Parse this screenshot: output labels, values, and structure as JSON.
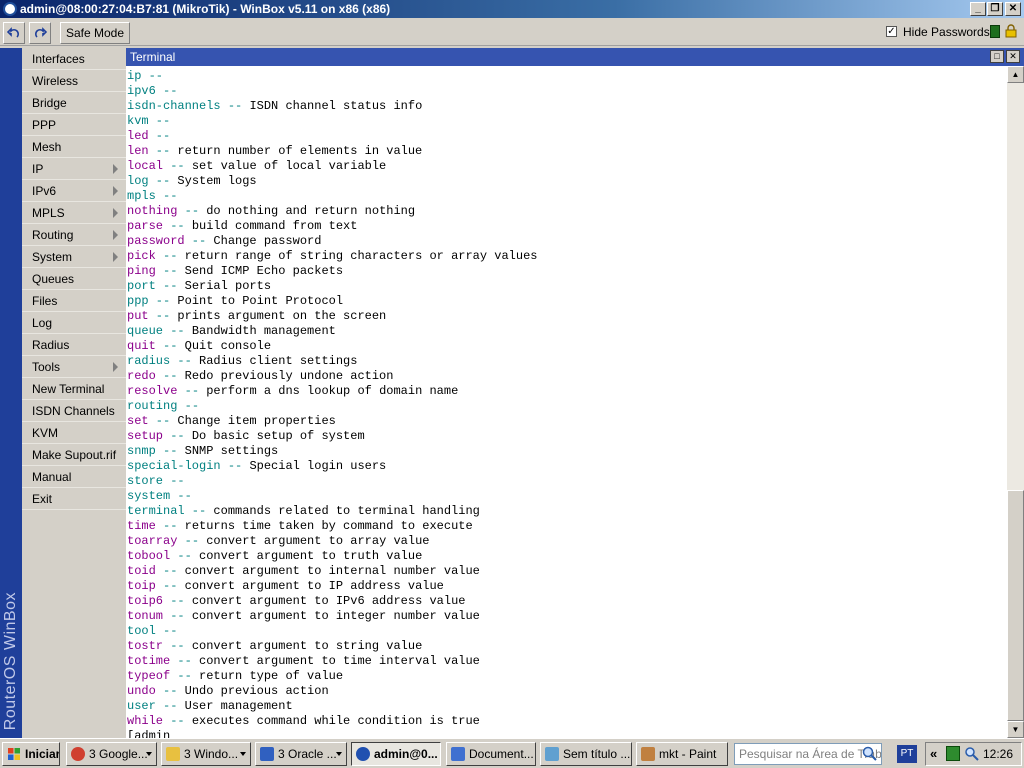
{
  "window": {
    "title": "admin@08:00:27:04:B7:81 (MikroTik) - WinBox v5.11 on x86 (x86)",
    "controls": [
      "_",
      "❐",
      "✕"
    ]
  },
  "toolbar": {
    "undo_icon": "undo-arrow",
    "redo_icon": "redo-arrow",
    "safe_mode_label": "Safe Mode",
    "hide_passwords_label": "Hide Passwords",
    "hide_passwords_checked": true,
    "status_color": "#1e6e1e"
  },
  "sidebar": {
    "brand": "RouterOS WinBox",
    "items": [
      {
        "label": "Interfaces",
        "submenu": false
      },
      {
        "label": "Wireless",
        "submenu": false
      },
      {
        "label": "Bridge",
        "submenu": false
      },
      {
        "label": "PPP",
        "submenu": false
      },
      {
        "label": "Mesh",
        "submenu": false
      },
      {
        "label": "IP",
        "submenu": true
      },
      {
        "label": "IPv6",
        "submenu": true
      },
      {
        "label": "MPLS",
        "submenu": true
      },
      {
        "label": "Routing",
        "submenu": true
      },
      {
        "label": "System",
        "submenu": true
      },
      {
        "label": "Queues",
        "submenu": false
      },
      {
        "label": "Files",
        "submenu": false
      },
      {
        "label": "Log",
        "submenu": false
      },
      {
        "label": "Radius",
        "submenu": false
      },
      {
        "label": "Tools",
        "submenu": true
      },
      {
        "label": "New Terminal",
        "submenu": false
      },
      {
        "label": "ISDN Channels",
        "submenu": false
      },
      {
        "label": "KVM",
        "submenu": false
      },
      {
        "label": "Make Supout.rif",
        "submenu": false
      },
      {
        "label": "Manual",
        "submenu": false
      },
      {
        "label": "Exit",
        "submenu": false
      }
    ]
  },
  "terminal": {
    "title": "Terminal",
    "lines": [
      {
        "cmd": "ip",
        "color": "teal",
        "desc": ""
      },
      {
        "cmd": "ipv6",
        "color": "teal",
        "desc": ""
      },
      {
        "cmd": "isdn-channels",
        "color": "teal",
        "desc": "ISDN channel status info"
      },
      {
        "cmd": "kvm",
        "color": "teal",
        "desc": ""
      },
      {
        "cmd": "led",
        "color": "purple",
        "desc": ""
      },
      {
        "cmd": "len",
        "color": "purple",
        "desc": "return number of elements in value"
      },
      {
        "cmd": "local",
        "color": "purple",
        "desc": "set value of local variable"
      },
      {
        "cmd": "log",
        "color": "teal",
        "desc": "System logs"
      },
      {
        "cmd": "mpls",
        "color": "teal",
        "desc": ""
      },
      {
        "cmd": "nothing",
        "color": "purple",
        "desc": "do nothing and return nothing"
      },
      {
        "cmd": "parse",
        "color": "purple",
        "desc": "build command from text"
      },
      {
        "cmd": "password",
        "color": "purple",
        "desc": "Change password"
      },
      {
        "cmd": "pick",
        "color": "purple",
        "desc": "return range of string characters or array values"
      },
      {
        "cmd": "ping",
        "color": "purple",
        "desc": "Send ICMP Echo packets"
      },
      {
        "cmd": "port",
        "color": "teal",
        "desc": "Serial ports"
      },
      {
        "cmd": "ppp",
        "color": "teal",
        "desc": "Point to Point Protocol"
      },
      {
        "cmd": "put",
        "color": "purple",
        "desc": "prints argument on the screen"
      },
      {
        "cmd": "queue",
        "color": "teal",
        "desc": "Bandwidth management"
      },
      {
        "cmd": "quit",
        "color": "purple",
        "desc": "Quit console"
      },
      {
        "cmd": "radius",
        "color": "teal",
        "desc": "Radius client settings"
      },
      {
        "cmd": "redo",
        "color": "purple",
        "desc": "Redo previously undone action"
      },
      {
        "cmd": "resolve",
        "color": "purple",
        "desc": "perform a dns lookup of domain name"
      },
      {
        "cmd": "routing",
        "color": "teal",
        "desc": ""
      },
      {
        "cmd": "set",
        "color": "purple",
        "desc": "Change item properties"
      },
      {
        "cmd": "setup",
        "color": "purple",
        "desc": "Do basic setup of system"
      },
      {
        "cmd": "snmp",
        "color": "teal",
        "desc": "SNMP settings"
      },
      {
        "cmd": "special-login",
        "color": "teal",
        "desc": "Special login users"
      },
      {
        "cmd": "store",
        "color": "teal",
        "desc": ""
      },
      {
        "cmd": "system",
        "color": "teal",
        "desc": ""
      },
      {
        "cmd": "terminal",
        "color": "teal",
        "desc": "commands related to terminal handling"
      },
      {
        "cmd": "time",
        "color": "purple",
        "desc": "returns time taken by command to execute"
      },
      {
        "cmd": "toarray",
        "color": "purple",
        "desc": "convert argument to array value"
      },
      {
        "cmd": "tobool",
        "color": "purple",
        "desc": "convert argument to truth value"
      },
      {
        "cmd": "toid",
        "color": "purple",
        "desc": "convert argument to internal number value"
      },
      {
        "cmd": "toip",
        "color": "purple",
        "desc": "convert argument to IP address value"
      },
      {
        "cmd": "toip6",
        "color": "purple",
        "desc": "convert argument to IPv6 address value"
      },
      {
        "cmd": "tonum",
        "color": "purple",
        "desc": "convert argument to integer number value"
      },
      {
        "cmd": "tool",
        "color": "teal",
        "desc": ""
      },
      {
        "cmd": "tostr",
        "color": "purple",
        "desc": "convert argument to string value"
      },
      {
        "cmd": "totime",
        "color": "purple",
        "desc": "convert argument to time interval value"
      },
      {
        "cmd": "typeof",
        "color": "purple",
        "desc": "return type of value"
      },
      {
        "cmd": "undo",
        "color": "purple",
        "desc": "Undo previous action"
      },
      {
        "cmd": "user",
        "color": "teal",
        "desc": "User management"
      },
      {
        "cmd": "while",
        "color": "purple",
        "desc": "executes command while condition is true"
      }
    ],
    "prompt_partial": "[admin",
    "separator": "--"
  },
  "colors": {
    "purple": "#8b008b",
    "teal": "#008080"
  },
  "taskbar": {
    "start_label": "Iniciar",
    "tasks": [
      {
        "label": "3 Google...",
        "icon": "chrome-icon",
        "dropdown": true,
        "active": false
      },
      {
        "label": "3 Windo...",
        "icon": "folder-icon",
        "dropdown": true,
        "active": false
      },
      {
        "label": "3 Oracle ...",
        "icon": "virtualbox-icon",
        "dropdown": true,
        "active": false
      },
      {
        "label": "admin@0...",
        "icon": "winbox-icon",
        "dropdown": false,
        "active": true
      },
      {
        "label": "Document...",
        "icon": "document-icon",
        "dropdown": false,
        "active": false
      },
      {
        "label": "Sem título ...",
        "icon": "notepad-icon",
        "dropdown": false,
        "active": false
      },
      {
        "label": "mkt - Paint",
        "icon": "paint-icon",
        "dropdown": false,
        "active": false
      }
    ],
    "search_placeholder": "Pesquisar na Área de Trabalho",
    "language": "PT",
    "clock": "12:26"
  }
}
